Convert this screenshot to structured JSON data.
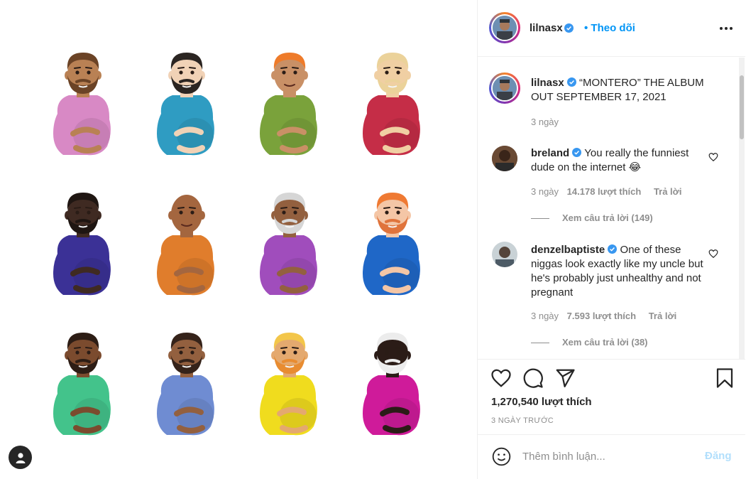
{
  "post": {
    "author": "lilnasx",
    "follow_label": "• Theo dõi",
    "caption": "“MONTERO” THE ALBUM OUT SEPTEMBER 17, 2021",
    "caption_age": "3 ngày",
    "likes": "1,270,540 lượt thích",
    "posted": "3 NGÀY TRƯỚC"
  },
  "comments": [
    {
      "user": "breland",
      "text": "You really the funniest dude on the internet 😂",
      "age": "3 ngày",
      "likes": "14.178 lượt thích",
      "reply_label": "Trả lời",
      "view_replies": "Xem câu trả lời (149)"
    },
    {
      "user": "denzelbaptiste",
      "text": "One of these niggas look exactly like my uncle but he's probably just unhealthy and not pregnant",
      "age": "3 ngày",
      "likes": "7.593 lượt thích",
      "reply_label": "Trả lời",
      "view_replies": "Xem câu trả lời (38)"
    }
  ],
  "composer": {
    "placeholder": "Thêm bình luận...",
    "post_label": "Đăng"
  },
  "icons": {
    "verified": "verified-badge-icon",
    "more": "more-options-icon",
    "like": "heart-icon",
    "comment": "comment-icon",
    "share": "share-icon",
    "save": "bookmark-icon",
    "emoji": "emoji-icon",
    "tag": "user-tag-icon"
  },
  "colors": {
    "accent": "#0095f6",
    "verified": "#3897f0",
    "muted": "#8e8e8e",
    "text": "#262626"
  },
  "emojis": [
    {
      "skin": "#b98154",
      "hair": "#6b4326",
      "beard": "#6b4326",
      "shirt": "#d889c5"
    },
    {
      "skin": "#f1d2b6",
      "hair": "#2b2522",
      "beard": "#2b2522",
      "shirt": "#2f9cc2"
    },
    {
      "skin": "#c99066",
      "hair": "#ee7b2a",
      "beard": "none",
      "shirt": "#7aa23b"
    },
    {
      "skin": "#f0cfa3",
      "hair": "#ebd29a",
      "beard": "#ebd29a",
      "shirt": "#c52d47"
    },
    {
      "skin": "#3f2a22",
      "hair": "#1f1612",
      "beard": "#1f1612",
      "shirt": "#3b3196"
    },
    {
      "skin": "#a4663f",
      "hair": "none",
      "beard": "none",
      "shirt": "#e07d2c"
    },
    {
      "skin": "#93603f",
      "hair": "#d6d6d6",
      "beard": "#d6d6d6",
      "shirt": "#a04dbc"
    },
    {
      "skin": "#f4c6a6",
      "hair": "#ef7a33",
      "beard": "#e0743c",
      "shirt": "#1f67c7"
    },
    {
      "skin": "#7b4b2e",
      "hair": "#2d1d15",
      "beard": "#2d1d15",
      "shirt": "#43c38b"
    },
    {
      "skin": "#93603f",
      "hair": "#35231a",
      "beard": "#35231a",
      "shirt": "#6f8cd2"
    },
    {
      "skin": "#e4a96f",
      "hair": "#f3c64a",
      "beard": "#e88c31",
      "shirt": "#f0dc1e"
    },
    {
      "skin": "#2b1c17",
      "hair": "#ececec",
      "beard": "#ececec",
      "shirt": "#cf1b9a"
    }
  ]
}
